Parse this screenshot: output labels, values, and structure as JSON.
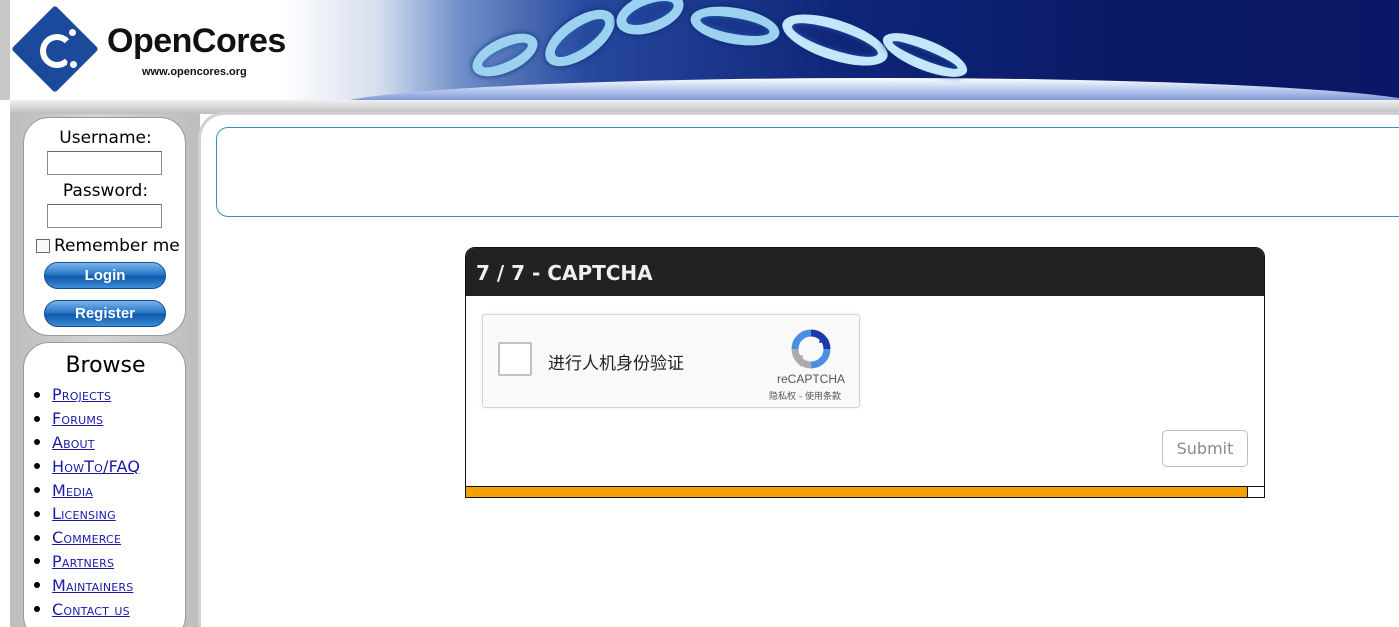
{
  "header": {
    "logo_text": "OpenCores",
    "logo_url": "www.opencores.org"
  },
  "login": {
    "username_label": "Username:",
    "password_label": "Password:",
    "username_value": "",
    "password_value": "",
    "remember_label": "Remember me",
    "login_button": "Login",
    "register_button": "Register"
  },
  "browse": {
    "title": "Browse",
    "items": [
      {
        "label": "Projects"
      },
      {
        "label": "Forums"
      },
      {
        "label": "About"
      },
      {
        "label": "HowTo/FAQ"
      },
      {
        "label": "Media"
      },
      {
        "label": "Licensing"
      },
      {
        "label": "Commerce"
      },
      {
        "label": "Partners"
      },
      {
        "label": "Maintainers"
      },
      {
        "label": "Contact us"
      }
    ]
  },
  "captcha": {
    "title": "7 / 7 - CAPTCHA",
    "checkbox_label": "进行人机身份验证",
    "brand": "reCAPTCHA",
    "links": "隐私权 - 使用条款",
    "submit_label": "Submit",
    "progress_fraction": 0.978
  },
  "colors": {
    "header_bg": "#222222",
    "progress": "#f4a100",
    "link": "#1a1aa8",
    "info_border": "#3b8bbd",
    "button_blue": "#2878c8"
  }
}
